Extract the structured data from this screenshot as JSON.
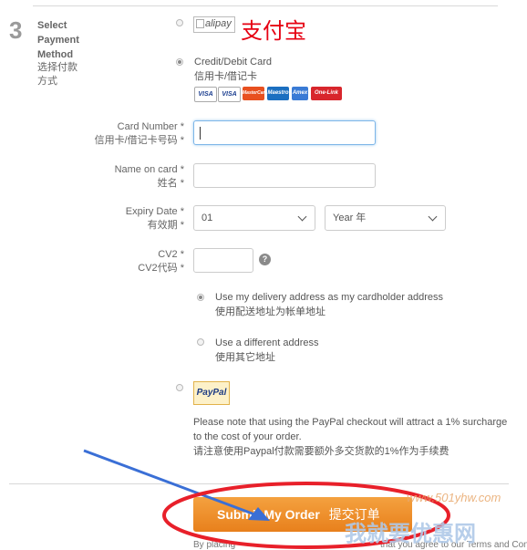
{
  "step": {
    "number": "3",
    "title": "Select Payment Method",
    "title_cn": "选择付款方式"
  },
  "alipay": {
    "image_alt": "alipay",
    "label": "支付宝",
    "label_color": "#e60012",
    "selected": false
  },
  "credit_card": {
    "label": "Credit/Debit Card",
    "label_cn": "信用卡/借记卡",
    "selected": true,
    "logos": [
      "VISA",
      "VISA",
      "MasterCard",
      "Maestro",
      "Amex",
      "One-Link"
    ]
  },
  "form": {
    "card_number": {
      "label": "Card Number *",
      "label_cn": "信用卡/借记卡号码 *",
      "value": ""
    },
    "name_on_card": {
      "label": "Name on card *",
      "label_cn": "姓名 *",
      "value": ""
    },
    "expiry": {
      "label": "Expiry Date *",
      "label_cn": "有效期 *",
      "month": "01",
      "year": "Year 年"
    },
    "cv2": {
      "label": "CV2 *",
      "label_cn": "CV2代码 *",
      "value": "",
      "help_icon": "question-circle-icon"
    }
  },
  "address": {
    "use_delivery": {
      "label": "Use my delivery address as my cardholder address",
      "label_cn": "使用配送地址为帐单地址",
      "selected": true
    },
    "use_different": {
      "label": "Use a different address",
      "label_cn": "使用其它地址",
      "selected": false
    }
  },
  "paypal": {
    "logo_text": "PayPal",
    "selected": false,
    "note": "Please note that using the PayPal checkout will attract a 1% surcharge to the cost of your order.",
    "note_cn": "请注意使用Paypal付款需要额外多交货款的1%作为手续费"
  },
  "submit": {
    "label": "Submit My Order",
    "label_cn": "提交订单",
    "color": "#e8801c"
  },
  "footer": {
    "text_left": "By placing",
    "text_right": "that you agree to our Terms and Con..."
  },
  "watermark": {
    "url": "www.501yhw.com",
    "text": "我就要优惠网"
  }
}
